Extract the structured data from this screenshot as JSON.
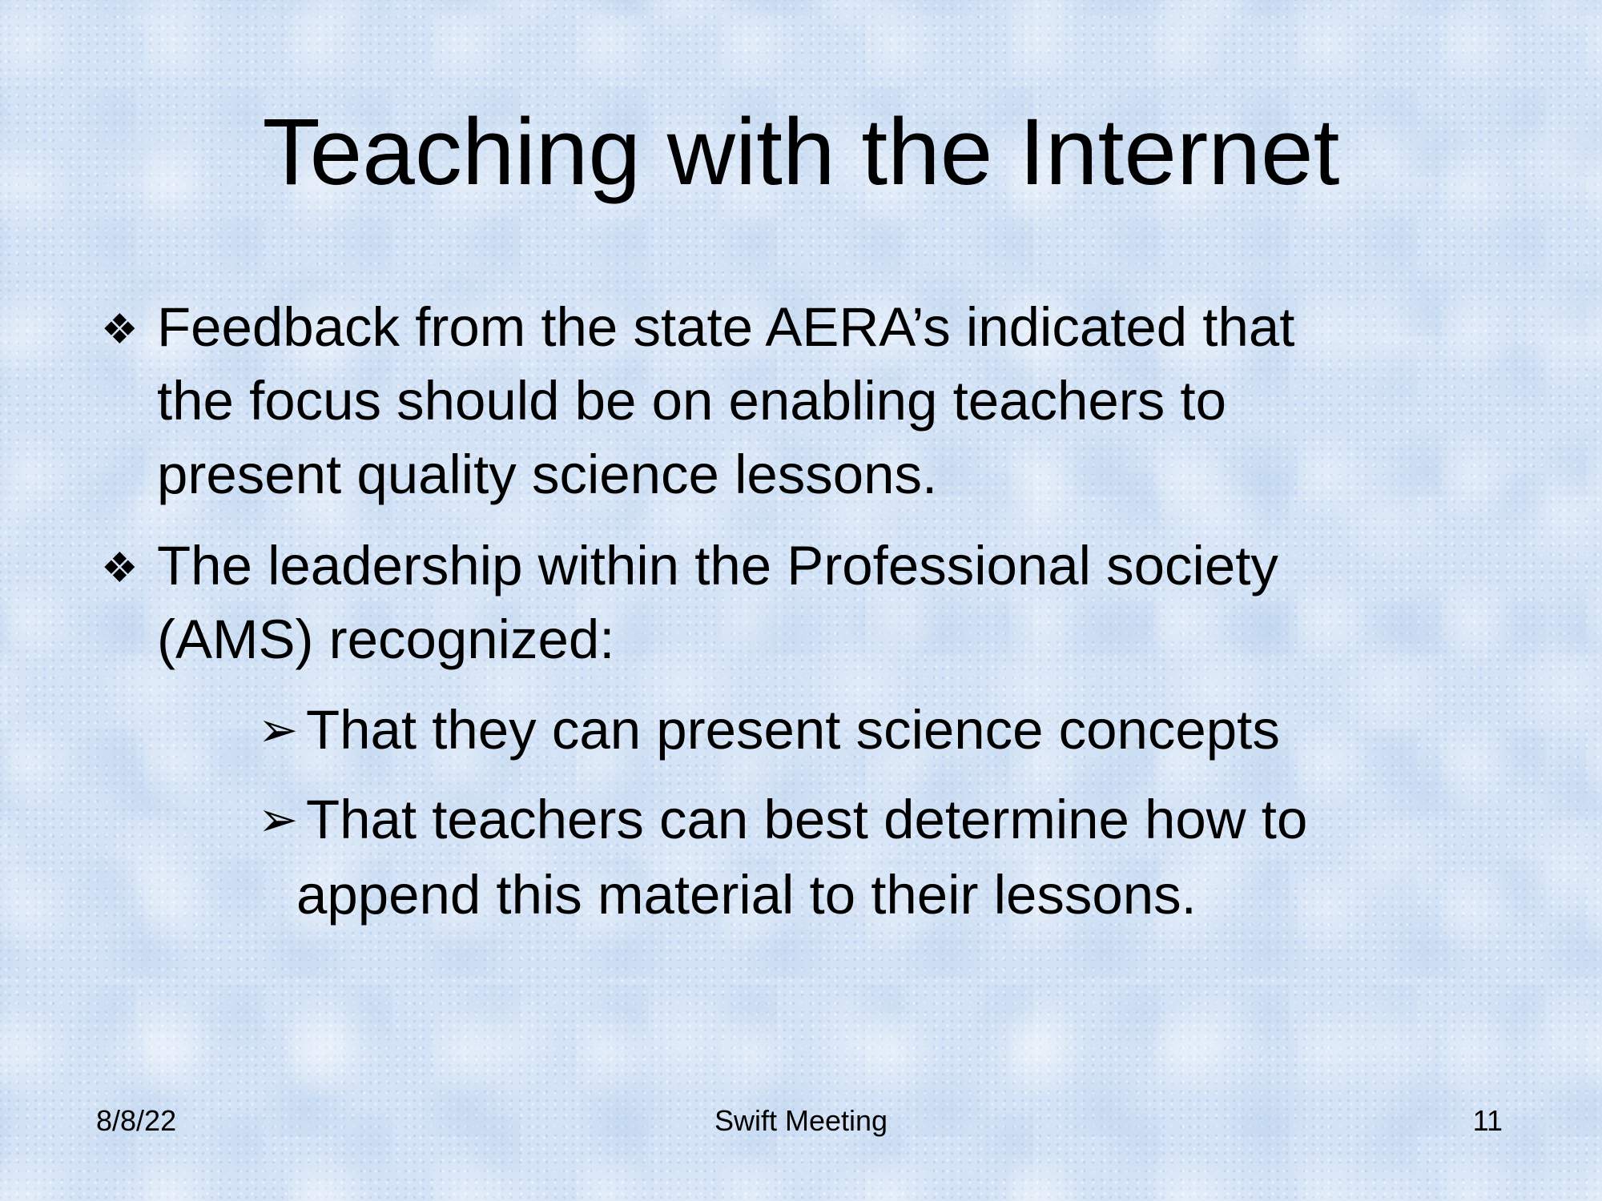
{
  "slide": {
    "title": "Teaching with the Internet",
    "bullets": [
      {
        "symbol": "❖",
        "lines": [
          "Feedback from the state AERA’s indicated that",
          "the focus should be on enabling teachers to",
          "present quality science lessons."
        ]
      },
      {
        "symbol": "❖",
        "lines": [
          "The leadership within the Professional society",
          "(AMS) recognized:"
        ]
      }
    ],
    "sub_bullets": [
      {
        "symbol": "➢",
        "lines": [
          "That they can present science concepts"
        ]
      },
      {
        "symbol": "➢",
        "lines": [
          "That teachers can best determine how to",
          "append this material to their lessons."
        ]
      }
    ],
    "footer": {
      "date": "8/8/22",
      "center": "Swift Meeting",
      "page": "11"
    }
  }
}
